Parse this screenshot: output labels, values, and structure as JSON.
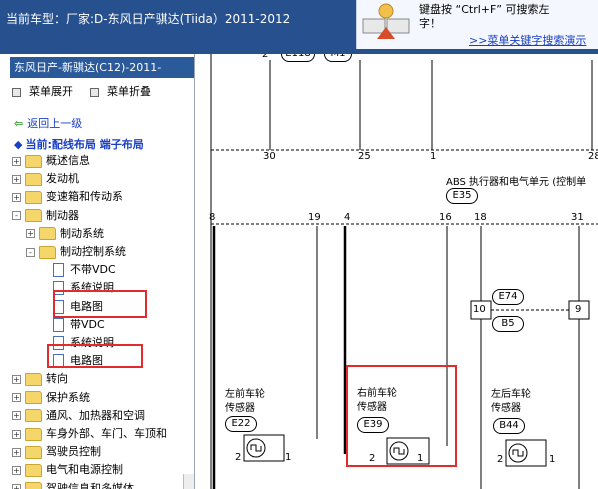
{
  "header": {
    "title": "当前车型：厂家:D-东风日产骐达(Tiida）2011-2012"
  },
  "promo": {
    "line1": "键盘按 “Ctrl+F” 可搜索左",
    "line2": "字！",
    "link": ">>菜单关键字搜索演示"
  },
  "sidebar": {
    "model_label": "东风日产-新骐达(C12)-2011-",
    "menu_expand": "菜单展开",
    "menu_collapse": "菜单折叠",
    "back": "返回上一级",
    "current": "当前:配线布局 端子布局",
    "tree": [
      {
        "label": "概述信息",
        "level": 0,
        "state": "+",
        "kind": "folder"
      },
      {
        "label": "发动机",
        "level": 0,
        "state": "+",
        "kind": "folder"
      },
      {
        "label": "变速箱和传动系",
        "level": 0,
        "state": "+",
        "kind": "folder"
      },
      {
        "label": "制动器",
        "level": 0,
        "state": "-",
        "kind": "folder"
      },
      {
        "label": "制动系统",
        "level": 1,
        "state": "+",
        "kind": "folder"
      },
      {
        "label": "制动控制系统",
        "level": 1,
        "state": "-",
        "kind": "folder"
      },
      {
        "label": "不带VDC",
        "level": 2,
        "state": "",
        "kind": "doc"
      },
      {
        "label": "系统说明",
        "level": 2,
        "state": "",
        "kind": "doc"
      },
      {
        "label": "电路图",
        "level": 2,
        "state": "",
        "kind": "doc"
      },
      {
        "label": "带VDC",
        "level": 2,
        "state": "",
        "kind": "doc"
      },
      {
        "label": "系统说明",
        "level": 2,
        "state": "",
        "kind": "doc"
      },
      {
        "label": "电路图",
        "level": 2,
        "state": "",
        "kind": "doc"
      },
      {
        "label": "转向",
        "level": 0,
        "state": "+",
        "kind": "folder"
      },
      {
        "label": "保护系统",
        "level": 0,
        "state": "+",
        "kind": "folder"
      },
      {
        "label": "通风、加热器和空调",
        "level": 0,
        "state": "+",
        "kind": "folder"
      },
      {
        "label": "车身外部、车门、车顶和",
        "level": 0,
        "state": "+",
        "kind": "folder"
      },
      {
        "label": "驾驶员控制",
        "level": 0,
        "state": "+",
        "kind": "folder"
      },
      {
        "label": "电气和电源控制",
        "level": 0,
        "state": "+",
        "kind": "folder"
      },
      {
        "label": "驾驶信息和多媒体",
        "level": 0,
        "state": "+",
        "kind": "folder"
      }
    ]
  },
  "diagram": {
    "top_connectors": [
      "E118",
      "M1"
    ],
    "top_pin": "2",
    "pins_row1": [
      "30",
      "25",
      "1",
      "28"
    ],
    "abs_label": "ABS 执行器和电气单元 (控制单",
    "abs_conn": "E35",
    "pins_row2": [
      "8",
      "19",
      "4",
      "16",
      "18",
      "31"
    ],
    "e74": "E74",
    "b5": "B5",
    "pin10": "10",
    "pin9": "9",
    "sensor_lf_l1": "左前车轮",
    "sensor_lf_l2": "传感器",
    "sensor_lf_conn": "E22",
    "sensor_rf_l1": "右前车轮",
    "sensor_rf_l2": "传感器",
    "sensor_rf_conn": "E39",
    "sensor_lr_l1": "左后车轮",
    "sensor_lr_l2": "传感器",
    "sensor_lr_conn": "B44",
    "pin_a": "2",
    "pin_b": "1"
  },
  "colors": {
    "header_bg": "#27508f",
    "highlight": "#e02c2c",
    "link": "#1a3fc4"
  }
}
